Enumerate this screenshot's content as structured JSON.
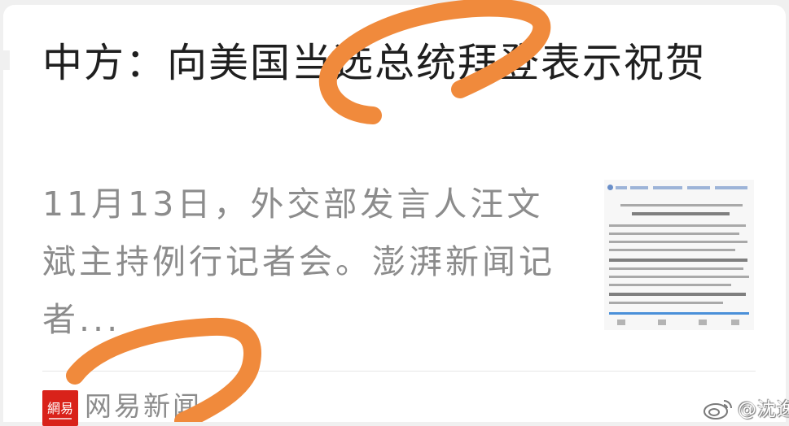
{
  "article": {
    "title": "中方：向美国当选总统拜登表示祝贺",
    "summary": "11月13日，外交部发言人汪文斌主持例行记者会。澎湃新闻记者...",
    "thumbnail_icon": "document-screenshot-thumbnail"
  },
  "source": {
    "logo_text": "網易",
    "name": "网易新闻",
    "logo_color": "#d9221a"
  },
  "watermark": {
    "text": "@沈逸",
    "icon": "weibo-icon"
  },
  "annotations": {
    "scribble_color": "#f08a3c"
  },
  "colors": {
    "title": "#1f1f1f",
    "summary": "#8c8c8c",
    "background": "#ffffff"
  }
}
